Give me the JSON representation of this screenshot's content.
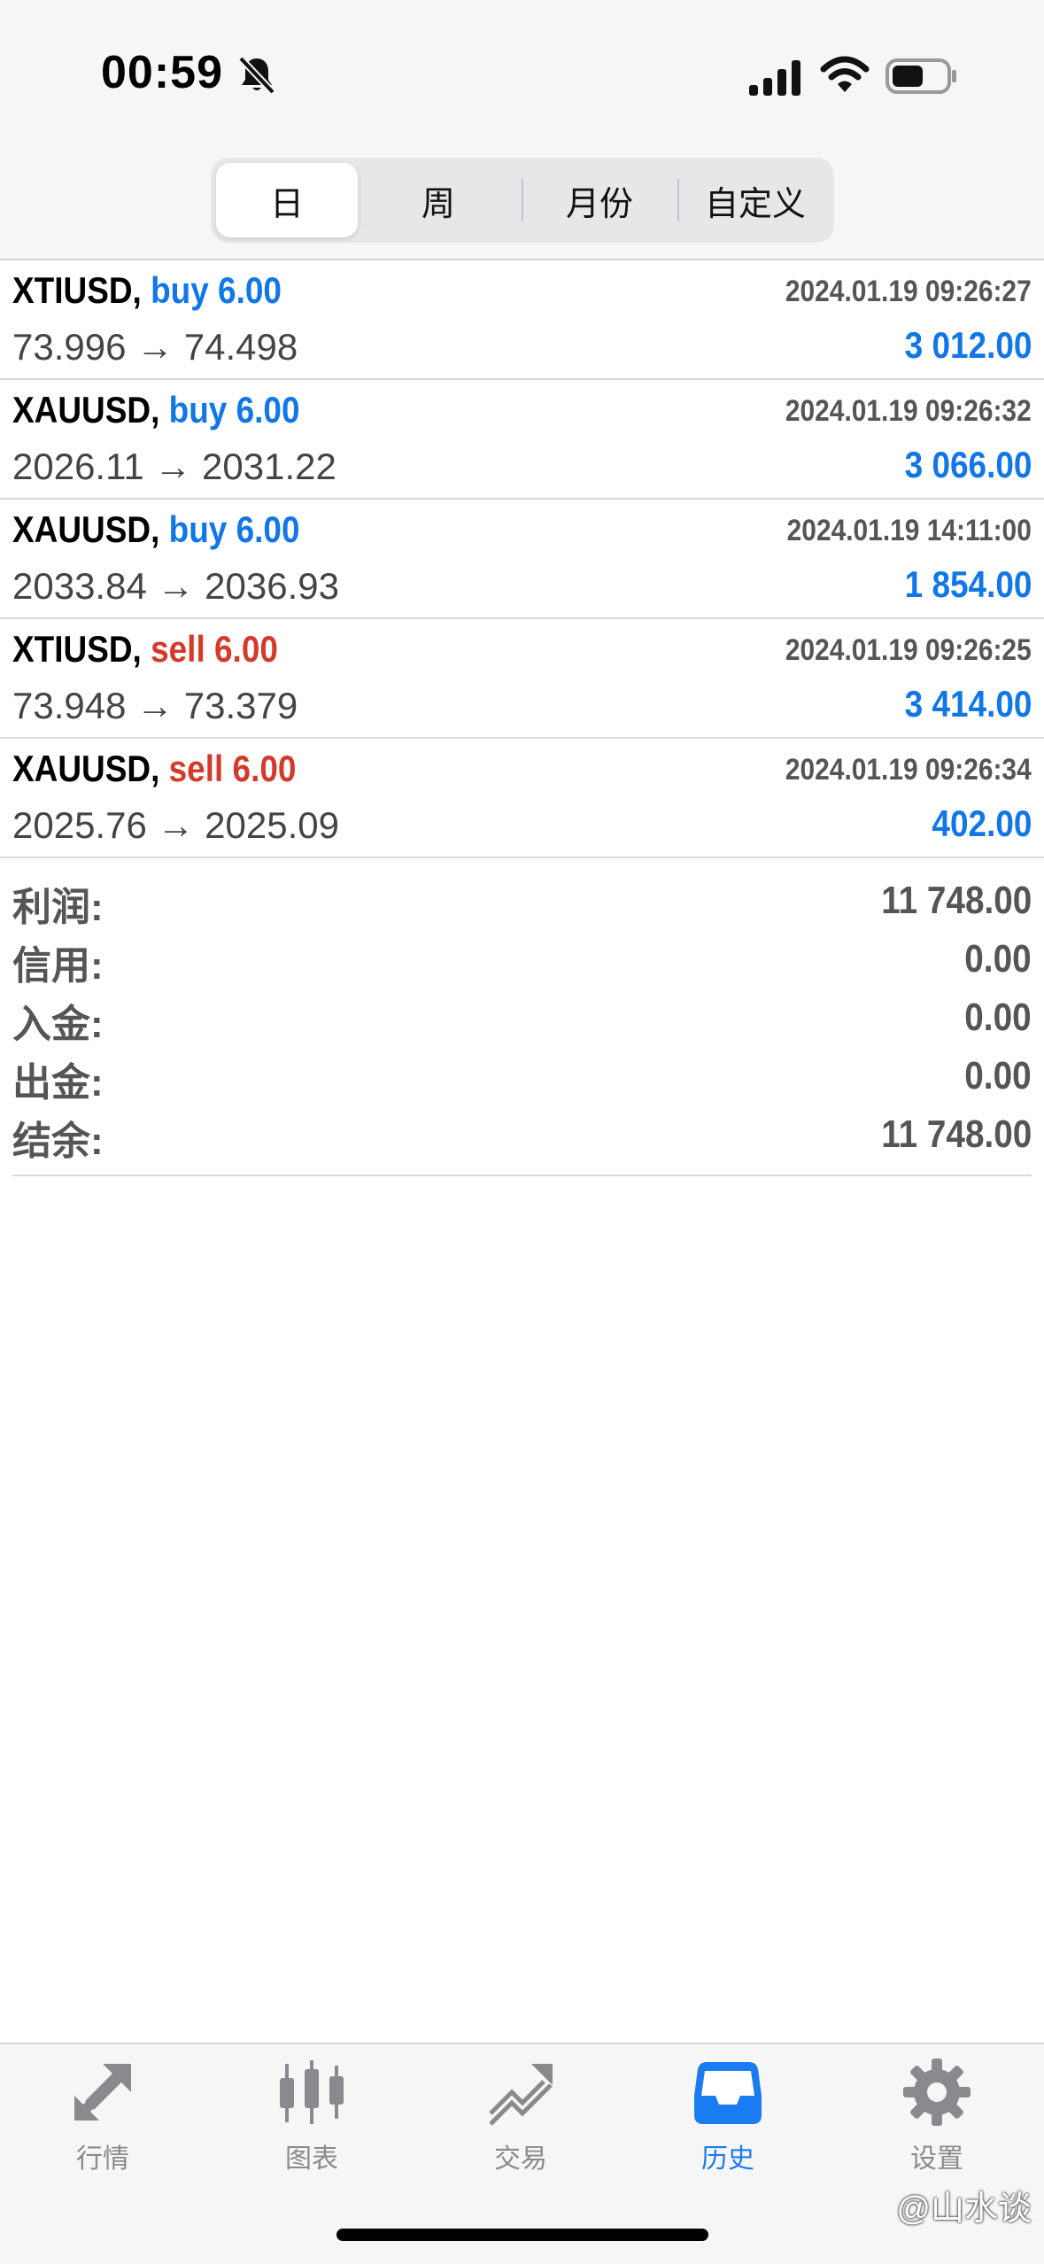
{
  "status_bar": {
    "time": "00:59"
  },
  "segments": [
    {
      "label": "日",
      "active": true
    },
    {
      "label": "周",
      "active": false
    },
    {
      "label": "月份",
      "active": false
    },
    {
      "label": "自定义",
      "active": false
    }
  ],
  "trades": [
    {
      "symbol": "XTIUSD,",
      "type": "buy 6.00",
      "side": "buy",
      "time": "2024.01.19 09:26:27",
      "prices": "73.996 → 74.498",
      "profit": "3 012.00"
    },
    {
      "symbol": "XAUUSD,",
      "type": "buy 6.00",
      "side": "buy",
      "time": "2024.01.19 09:26:32",
      "prices": "2026.11 → 2031.22",
      "profit": "3 066.00"
    },
    {
      "symbol": "XAUUSD,",
      "type": "buy 6.00",
      "side": "buy",
      "time": "2024.01.19 14:11:00",
      "prices": "2033.84 → 2036.93",
      "profit": "1 854.00"
    },
    {
      "symbol": "XTIUSD,",
      "type": "sell 6.00",
      "side": "sell",
      "time": "2024.01.19 09:26:25",
      "prices": "73.948 → 73.379",
      "profit": "3 414.00"
    },
    {
      "symbol": "XAUUSD,",
      "type": "sell 6.00",
      "side": "sell",
      "time": "2024.01.19 09:26:34",
      "prices": "2025.76 → 2025.09",
      "profit": "402.00"
    }
  ],
  "summary": [
    {
      "label": "利润:",
      "value": "11 748.00"
    },
    {
      "label": "信用:",
      "value": "0.00"
    },
    {
      "label": "入金:",
      "value": "0.00"
    },
    {
      "label": "出金:",
      "value": "0.00"
    },
    {
      "label": "结余:",
      "value": "11 748.00"
    }
  ],
  "tabbar": [
    {
      "label": "行情",
      "icon": "quotes-arrows-icon",
      "active": false
    },
    {
      "label": "图表",
      "icon": "candlestick-chart-icon",
      "active": false
    },
    {
      "label": "交易",
      "icon": "trade-trend-icon",
      "active": false
    },
    {
      "label": "历史",
      "icon": "history-inbox-icon",
      "active": true
    },
    {
      "label": "设置",
      "icon": "gear-icon",
      "active": false
    }
  ],
  "watermark": "@山水谈",
  "colors": {
    "buy": "#1177e6",
    "sell": "#d43a2a",
    "accent": "#1a7cf0",
    "inactive": "#8a8a8e"
  }
}
